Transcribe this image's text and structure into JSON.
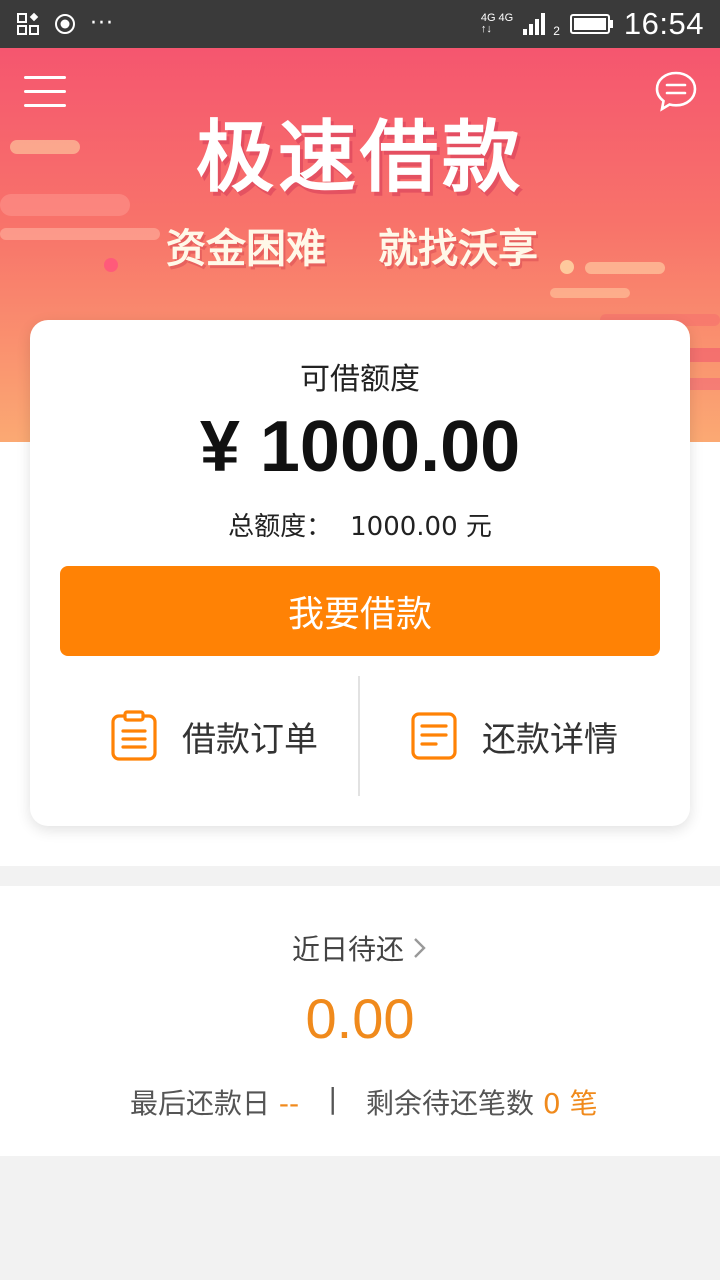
{
  "status_bar": {
    "time": "16:54",
    "network_top": "4G 4G",
    "network_bottom": "↑↓",
    "sim_slot": "2",
    "more": "···",
    "icons": [
      "app-grid-icon",
      "record-icon",
      "signal-icon",
      "battery-icon"
    ]
  },
  "hero": {
    "title": "极速借款",
    "slogan_left": "资金困难",
    "slogan_right": "就找沃享",
    "icons": [
      "menu-icon",
      "chat-icon"
    ]
  },
  "card": {
    "quota_label": "可借额度",
    "amount": "¥ 1000.00",
    "total_label": "总额度：",
    "total_value": "1000.00 元",
    "borrow_button": "我要借款",
    "orders_label": "借款订单",
    "repay_label": "还款详情"
  },
  "repay": {
    "title": "近日待还",
    "amount": "0.00",
    "last_day_label": "最后还款日",
    "last_day_value": "--",
    "separator": "|",
    "remaining_label": "剩余待还笔数",
    "remaining_count": "0",
    "remaining_unit": "笔"
  },
  "colors": {
    "accent": "#ff8205",
    "amount_orange": "#f08a1c",
    "hero_top": "#f5566f",
    "hero_bottom": "#fba973"
  }
}
